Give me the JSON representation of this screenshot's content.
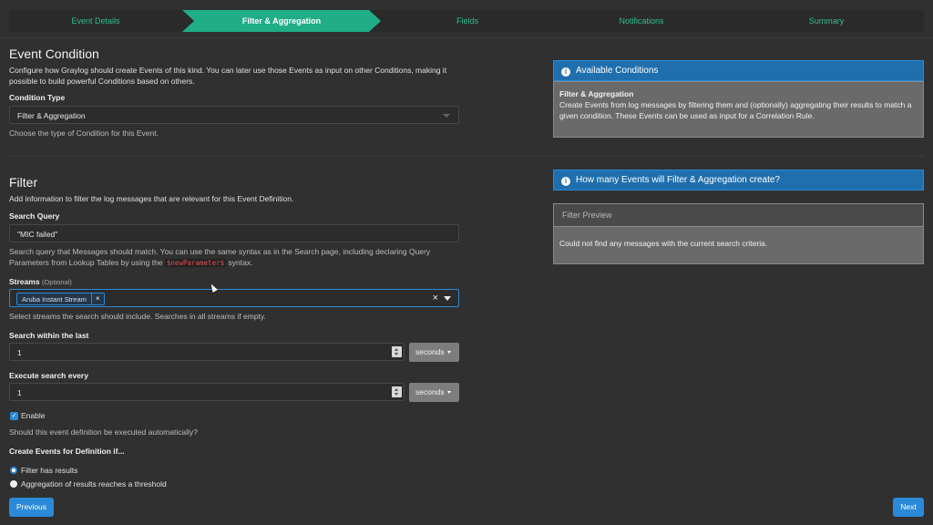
{
  "wizard": {
    "steps": [
      "Event Details",
      "Filter & Aggregation",
      "Fields",
      "Notifications",
      "Summary"
    ],
    "active_index": 1
  },
  "event_condition": {
    "title": "Event Condition",
    "description": "Configure how Graylog should create Events of this kind. You can later use those Events as input on other Conditions, making it possible to build powerful Conditions based on others.",
    "condition_type_label": "Condition Type",
    "condition_type_value": "Filter & Aggregation",
    "condition_type_help": "Choose the type of Condition for this Event."
  },
  "filter": {
    "title": "Filter",
    "description": "Add information to filter the log messages that are relevant for this Event Definition.",
    "search_query_label": "Search Query",
    "search_query_value": "\"MIC failed\"",
    "search_query_help_1": "Search query that Messages should match. You can use the same syntax as in the Search page, including declaring Query",
    "search_query_help_2a": "Parameters from Lookup Tables by using the",
    "search_query_help_code": "$newParameter$",
    "search_query_help_2b": "syntax.",
    "streams_label": "Streams",
    "streams_optional": "(Optional)",
    "streams_selected": "Aruba Instant Stream",
    "streams_chip_remove": "×",
    "streams_clear": "×",
    "streams_help": "Select streams the search should include. Searches in all streams if empty.",
    "search_within_label": "Search within the last",
    "search_within_value": "1",
    "search_within_unit": "seconds",
    "execute_every_label": "Execute search every",
    "execute_every_value": "1",
    "execute_every_unit": "seconds",
    "enable_label": "Enable",
    "enable_checked": true,
    "enable_help": "Should this event definition be executed automatically?",
    "create_events_label": "Create Events for Definition if...",
    "radio_filter": "Filter has results",
    "radio_aggregation": "Aggregation of results reaches a threshold",
    "selected_radio": "radio_filter"
  },
  "available_conditions": {
    "title": "Available Conditions",
    "body_title": "Filter & Aggregation",
    "body_text": "Create Events from log messages by filtering them and (optionally) aggregating their results to match a given condition. These Events can be used as input for a Correlation Rule."
  },
  "how_many": {
    "title": "How many Events will Filter & Aggregation create?",
    "preview_title": "Filter Preview",
    "preview_text": "Could not find any messages with the current search criteria."
  },
  "footer": {
    "previous": "Previous",
    "next": "Next"
  },
  "icons": {
    "info": "i",
    "check": "✓"
  },
  "colors": {
    "accent": "#1fae86",
    "primary": "#2a8ad8",
    "background": "#303030"
  }
}
